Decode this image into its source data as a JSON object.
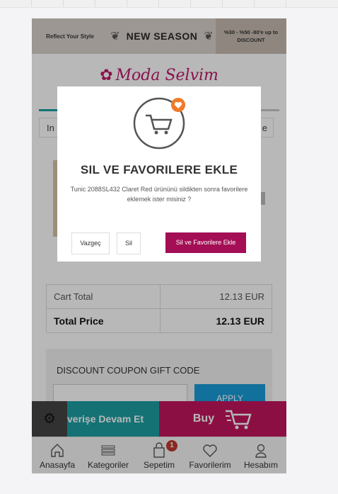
{
  "banner": {
    "left_text": "Reflect Your Style",
    "title": "NEW SEASON",
    "discount_line1": "%30 - %50 -80'e up to",
    "discount_line2": "DISCOUNT"
  },
  "logo": {
    "text": "Moda Selvim"
  },
  "tabs": {
    "left": "In",
    "right": "e"
  },
  "totals": [
    {
      "label": "Cart Total",
      "value": "12.13 EUR"
    },
    {
      "label": "Total Price",
      "value": "12.13 EUR"
    }
  ],
  "coupon": {
    "title": "DISCOUNT COUPON GIFT CODE",
    "button": "APPLY"
  },
  "actions": {
    "continue": "verişe Devam Et",
    "buy": "Buy"
  },
  "nav": [
    {
      "label": "Anasayfa",
      "icon": "home-icon"
    },
    {
      "label": "Kategoriler",
      "icon": "list-icon"
    },
    {
      "label": "Sepetim",
      "icon": "bag-icon",
      "badge": "1"
    },
    {
      "label": "Favorilerim",
      "icon": "heart-icon"
    },
    {
      "label": "Hesabım",
      "icon": "user-icon"
    }
  ],
  "modal": {
    "title": "SIL VE FAVORILERE EKLE",
    "text": "Tunic 2088SL432 Claret Red ürününü sildikten sonra favorilere eklemek ister misiniz ?",
    "cancel": "Vazgeç",
    "delete": "Sil",
    "confirm": "Sil ve Favorilere Ekle"
  },
  "colors": {
    "accent": "#1c9fa3",
    "brand": "#c2165f",
    "modal_button": "#a30e55",
    "badge": "#c0392b",
    "heart_badge": "#f07a2a"
  }
}
